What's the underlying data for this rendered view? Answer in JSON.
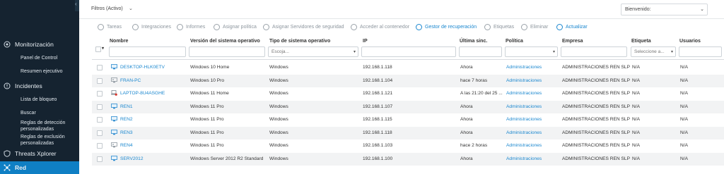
{
  "sidebar": {
    "sections": [
      {
        "label": "Monitorización",
        "icon": "monitor-icon"
      },
      {
        "label": "Incidentes",
        "icon": "incidents-icon"
      },
      {
        "label": "Threats Xplorer",
        "icon": "shield-icon"
      },
      {
        "label": "Red",
        "icon": "network-icon"
      }
    ],
    "monitoring_items": [
      "Panel de Control",
      "Resumen ejecutivo"
    ],
    "incidents_items": [
      "Lista de bloqueo",
      "Buscar",
      "Reglas de detección personalizadas",
      "Reglas de exclusión personalizadas"
    ]
  },
  "topbar": {
    "filters_label": "Filtros (Activo)",
    "welcome_label": "Bienvenido:"
  },
  "toolbar": {
    "items": [
      {
        "label": "Tareas",
        "icon": "tasks-icon"
      },
      {
        "label": "Integraciones",
        "icon": "integrations-icon"
      },
      {
        "label": "Informes",
        "icon": "reports-icon"
      },
      {
        "label": "Asignar política",
        "icon": "assign-policy-icon"
      },
      {
        "label": "Asignar Servidores de seguridad",
        "icon": "assign-servers-icon"
      },
      {
        "label": "Acceder al contenedor",
        "icon": "container-icon"
      },
      {
        "label": "Gestor de recuperación",
        "icon": "recovery-icon"
      },
      {
        "label": "Etiquetas",
        "icon": "tags-icon"
      },
      {
        "label": "Eliminar",
        "icon": "delete-icon"
      },
      {
        "label": "Actualizar",
        "icon": "refresh-icon"
      }
    ]
  },
  "table": {
    "columns": [
      "Nombre",
      "Versión del sistema operativo",
      "Tipo de sistema operativo",
      "IP",
      "Última sinc.",
      "Política",
      "Empresa",
      "Etiqueta",
      "Usuarios"
    ],
    "filters": {
      "os_type_placeholder": "Escoja...",
      "tag_placeholder": "Seleccione a..."
    },
    "rows": [
      {
        "name": "DESKTOP-HLK0ETV",
        "os_version": "Windows 10 Home",
        "os_type": "Windows",
        "ip": "192.168.1.118",
        "sync": "Ahora",
        "policy": "Administraciones",
        "company": "ADMINISTRACIONES REN SLP",
        "tag": "N/A",
        "users": "N/A",
        "icon": "desktop-icon"
      },
      {
        "name": "FRAN-PC",
        "os_version": "Windows 10 Pro",
        "os_type": "Windows",
        "ip": "192.168.1.104",
        "sync": "hace 7 horas",
        "policy": "Administraciones",
        "company": "ADMINISTRACIONES REN SLP",
        "tag": "N/A",
        "users": "N/A",
        "icon": "desktop-offline-icon"
      },
      {
        "name": "LAPTOP-8U4ASGHE",
        "os_version": "Windows 11 Home",
        "os_type": "Windows",
        "ip": "192.168.1.121",
        "sync": "A las 21:20 del 25 ...",
        "policy": "Administraciones",
        "company": "ADMINISTRACIONES REN SLP",
        "tag": "N/A",
        "users": "N/A",
        "icon": "laptop-alert-icon"
      },
      {
        "name": "REN1",
        "os_version": "Windows 11 Pro",
        "os_type": "Windows",
        "ip": "192.168.1.107",
        "sync": "Ahora",
        "policy": "Administraciones",
        "company": "ADMINISTRACIONES REN SLP",
        "tag": "N/A",
        "users": "N/A",
        "icon": "desktop-icon"
      },
      {
        "name": "REN2",
        "os_version": "Windows 11 Pro",
        "os_type": "Windows",
        "ip": "192.168.1.115",
        "sync": "Ahora",
        "policy": "Administraciones",
        "company": "ADMINISTRACIONES REN SLP",
        "tag": "N/A",
        "users": "N/A",
        "icon": "desktop-icon"
      },
      {
        "name": "REN3",
        "os_version": "Windows 11 Pro",
        "os_type": "Windows",
        "ip": "192.168.1.118",
        "sync": "Ahora",
        "policy": "Administraciones",
        "company": "ADMINISTRACIONES REN SLP",
        "tag": "N/A",
        "users": "N/A",
        "icon": "desktop-icon"
      },
      {
        "name": "REN4",
        "os_version": "Windows 11 Pro",
        "os_type": "Windows",
        "ip": "192.168.1.103",
        "sync": "hace 2 horas",
        "policy": "Administraciones",
        "company": "ADMINISTRACIONES REN SLP",
        "tag": "N/A",
        "users": "N/A",
        "icon": "desktop-offline-icon"
      },
      {
        "name": "SERV2012",
        "os_version": "Windows Server 2012 R2 Standard",
        "os_type": "Windows",
        "ip": "192.168.1.100",
        "sync": "Ahora",
        "policy": "Administraciones",
        "company": "ADMINISTRACIONES REN SLP",
        "tag": "N/A",
        "users": "N/A",
        "icon": "server-icon"
      }
    ]
  },
  "colors": {
    "sidebar_bg": "#152330",
    "active_nav": "#0f7fc4",
    "link": "#1a87cf",
    "alert": "#d9342b"
  }
}
